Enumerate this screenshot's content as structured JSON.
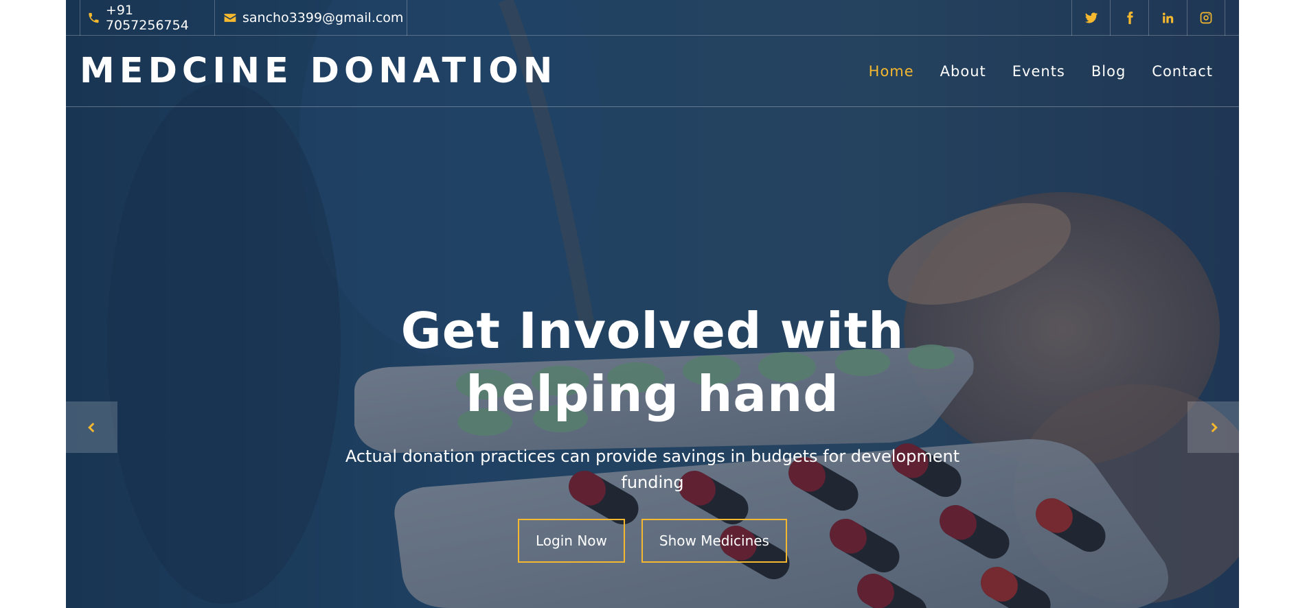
{
  "topbar": {
    "phone": "+91 7057256754",
    "email": "sancho3399@gmail.com",
    "socials": [
      "twitter-icon",
      "facebook-icon",
      "linkedin-icon",
      "instagram-icon"
    ]
  },
  "navbar": {
    "logo": "MEDCINE DONATION",
    "menu": [
      {
        "label": "Home",
        "active": true
      },
      {
        "label": "About",
        "active": false
      },
      {
        "label": "Events",
        "active": false
      },
      {
        "label": "Blog",
        "active": false
      },
      {
        "label": "Contact",
        "active": false
      }
    ]
  },
  "hero": {
    "title_line1": "Get Involved with",
    "title_line2": "helping hand",
    "subtitle": "Actual donation practices can provide savings in budgets for development funding",
    "buttons": {
      "login": "Login Now",
      "show_medicines": "Show Medicines"
    }
  },
  "carousel": {
    "prev_icon": "chevron-left-icon",
    "next_icon": "chevron-right-icon"
  },
  "colors": {
    "accent": "#f5b82e",
    "text": "#ffffff",
    "overlay": "#14243a"
  }
}
